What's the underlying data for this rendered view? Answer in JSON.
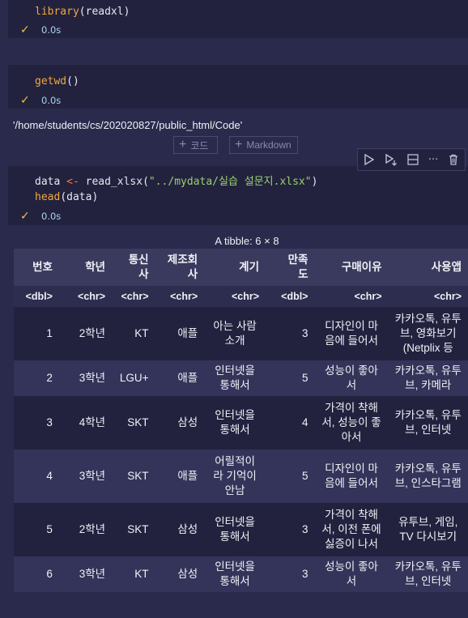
{
  "cells": [
    {
      "fn": "library",
      "args": "(readxl)",
      "time": "0.0s"
    },
    {
      "fn": "getwd",
      "args": "()",
      "time": "0.0s",
      "output": "'/home/students/cs/202020827/public_html/Code'"
    },
    {
      "line1_var": "data",
      "line1_op": " <- ",
      "line1_fn": "read_xlsx",
      "line1_open": "(",
      "line1_str": "\"../mydata/실습 설문지.xlsx\"",
      "line1_close": ")",
      "line2_fn": "head",
      "line2_args": "(data)",
      "time": "0.0s"
    }
  ],
  "add_buttons": {
    "code": "코드",
    "markdown": "Markdown"
  },
  "toolbar_icons": [
    "run-icon",
    "run-below-icon",
    "split-icon",
    "more-icon",
    "delete-icon"
  ],
  "table": {
    "title": "A tibble: 6 × 8",
    "headers": [
      "번호",
      "학년",
      "통신\n사",
      "제조회\n사",
      "계기",
      "만족\n도",
      "구매이유",
      "사용앱"
    ],
    "types": [
      "<dbl>",
      "<chr>",
      "<chr>",
      "<chr>",
      "<chr>",
      "<dbl>",
      "<chr>",
      "<chr>"
    ],
    "rows": [
      [
        "1",
        "2학년",
        "KT",
        "애플",
        "아는 사람\n소개",
        "3",
        "디자인이 마\n음에 들어서",
        "카카오톡, 유투\n브, 영화보기\n(Netplix 등"
      ],
      [
        "2",
        "3학년",
        "LGU+",
        "애플",
        "인터넷을\n통해서",
        "5",
        "성능이 좋아\n서",
        "카카오톡, 유투\n브, 카메라"
      ],
      [
        "3",
        "4학년",
        "SKT",
        "삼성",
        "인터넷을\n통해서",
        "4",
        "가격이 착해\n서, 성능이 좋\n아서",
        "카카오톡, 유투\n브, 인터넷"
      ],
      [
        "4",
        "3학년",
        "SKT",
        "애플",
        "어릴적이\n라 기억이\n안남",
        "5",
        "디자인이 마\n음에 들어서",
        "카카오톡, 유투\n브, 인스타그램"
      ],
      [
        "5",
        "2학년",
        "SKT",
        "삼성",
        "인터넷을\n통해서",
        "3",
        "가격이 착해\n서, 이전 폰에\n싫증이 나서",
        "유투브, 게임,\nTV 다시보기"
      ],
      [
        "6",
        "3학년",
        "KT",
        "삼성",
        "인터넷을\n통해서",
        "3",
        "성능이 좋아\n서",
        "카카오톡, 유투\n브, 인터넷"
      ]
    ]
  }
}
